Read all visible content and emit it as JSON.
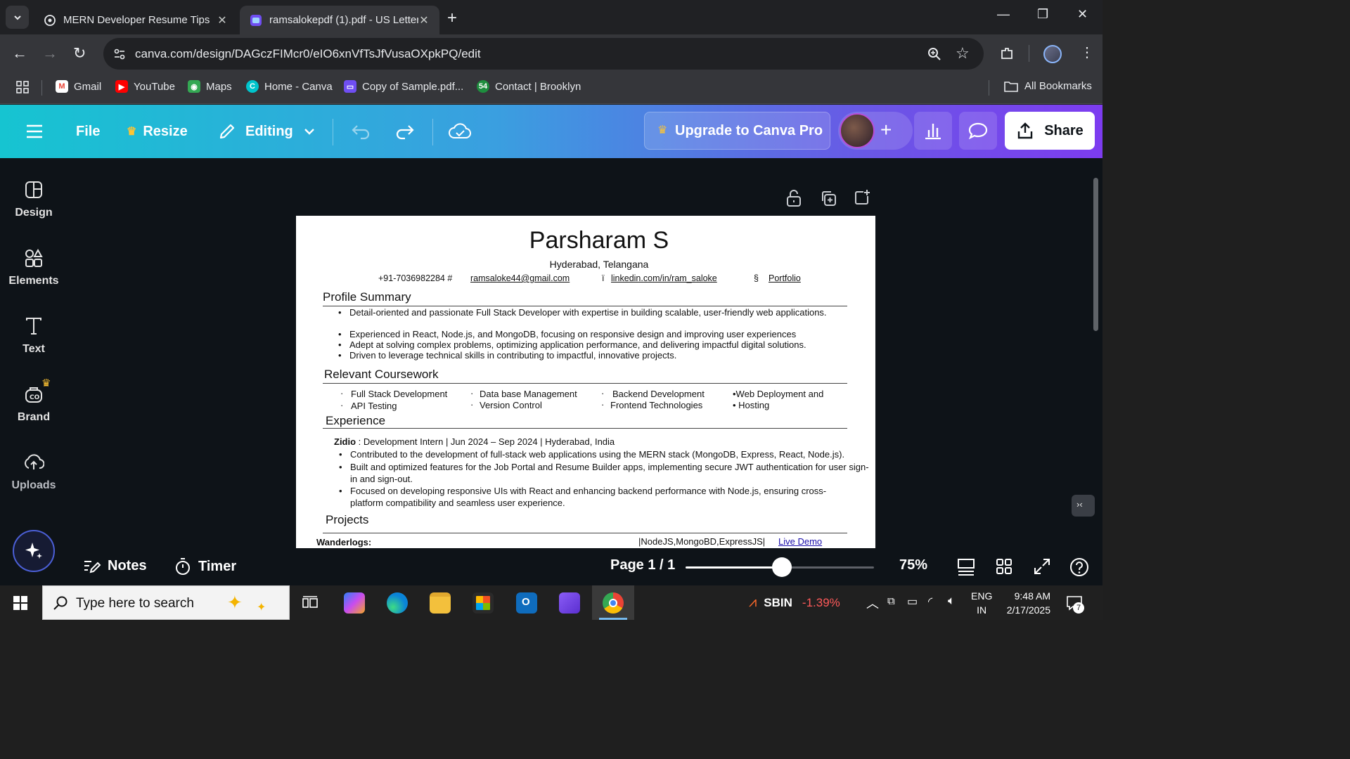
{
  "browser": {
    "tabs": [
      {
        "title": "MERN Developer Resume Tips",
        "active": false
      },
      {
        "title": "ramsalokepdf (1).pdf - US Letter",
        "active": true
      }
    ],
    "url": "canva.com/design/DAGczFIMcr0/eIO6xnVfTsJfVusaOXpkPQ/edit",
    "bookmarks": [
      "Gmail",
      "YouTube",
      "Maps",
      "Home - Canva",
      "Copy of Sample.pdf...",
      "Contact | Brooklyn"
    ],
    "all_bookmarks": "All Bookmarks"
  },
  "canva_header": {
    "file": "File",
    "resize": "Resize",
    "editing": "Editing",
    "upgrade": "Upgrade to Canva Pro",
    "share": "Share"
  },
  "sidebar": {
    "items": [
      "Design",
      "Elements",
      "Text",
      "Brand",
      "Uploads"
    ]
  },
  "resume": {
    "name": "Parsharam S",
    "location": "Hyderabad, Telangana",
    "phone": "+91-7036982284 #",
    "email": "ramsaloke44@gmail.com",
    "linkedin_prefix": "ï",
    "linkedin": "linkedin.com/in/ram_saloke",
    "portfolio_prefix": "§",
    "portfolio": "Portfolio",
    "profile_title": "Profile Summary",
    "profile_bullets": [
      "Detail-oriented and passionate Full Stack Developer with expertise in building scalable, user-friendly web applications.",
      "Experienced in React, Node.js, and MongoDB, focusing on responsive design and improving user experiences",
      "Adept at solving complex problems, optimizing application performance, and delivering impactful digital solutions.",
      "Driven to leverage technical skills in contributing to impactful, innovative projects."
    ],
    "coursework_title": "Relevant Coursework",
    "coursework": [
      [
        "Full Stack Development",
        "API Testing"
      ],
      [
        "Data base Management",
        "Version Control"
      ],
      [
        "Backend Development",
        "Frontend Technologies"
      ],
      [
        "•Web Deployment and",
        "• Hosting"
      ]
    ],
    "experience_title": "Experience",
    "exp_company": "Zidio",
    "exp_role": " : Development Intern | Jun 2024 – Sep 2024 | Hyderabad, India",
    "exp_bullets": [
      "Contributed to the development of full-stack web applications using the MERN stack (MongoDB, Express, React, Node.js).",
      "Built and optimized features for the Job Portal and Resume Builder apps, implementing secure JWT authentication for user sign-in and sign-out.",
      "Focused on developing responsive UIs with React and enhancing backend performance with Node.js, ensuring cross-platform compatibility and seamless user experience."
    ],
    "projects_title": "Projects",
    "project_name": "Wanderlogs:",
    "project_stack": "|NodeJS,MongoBD,ExpressJS|",
    "project_link": "Live Demo"
  },
  "footer": {
    "notes": "Notes",
    "timer": "Timer",
    "page": "Page 1 / 1",
    "zoom": "75%",
    "zoom_level": 0.51
  },
  "taskbar": {
    "search_placeholder": "Type here to search",
    "stock": "SBIN",
    "stock_change": "-1.39%",
    "lang": "ENG",
    "region": "IN",
    "time": "9:48 AM",
    "date": "2/17/2025",
    "notif_count": "7"
  },
  "colors": {
    "stock_red": "#ff5a5a",
    "share_bg": "#ffffff",
    "crown": "#ffc533"
  }
}
